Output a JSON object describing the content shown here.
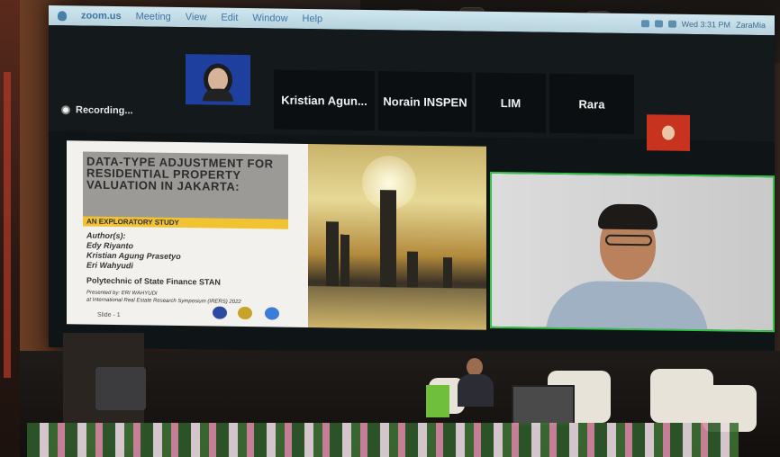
{
  "menubar": {
    "app_name": "zoom.us",
    "items": [
      "Meeting",
      "View",
      "Edit",
      "Window",
      "Help"
    ],
    "clock": "Wed 3:31 PM",
    "account": "ZaraMia"
  },
  "recording": {
    "label": "Recording..."
  },
  "participants": [
    {
      "name": "",
      "has_video": true
    },
    {
      "name": "Kristian Agun...",
      "has_video": false
    },
    {
      "name": "Norain INSPEN",
      "has_video": false
    },
    {
      "name": "LIM",
      "has_video": false
    },
    {
      "name": "Rara",
      "has_video": false
    },
    {
      "name": "",
      "has_video": true
    }
  ],
  "slide": {
    "title": "DATA-TYPE ADJUSTMENT FOR RESIDENTIAL PROPERTY VALUATION IN JAKARTA:",
    "subtitle": "AN EXPLORATORY STUDY",
    "authors_label": "Author(s):",
    "authors": [
      "Edy Riyanto",
      "Kristian Agung Prasetyo",
      "Eri Wahyudi"
    ],
    "institution": "Polytechnic of State Finance STAN",
    "presented_by": "Presented by: ERI WAHYUDI",
    "event": "at International Real Estate Research Symposium (IRERS) 2022",
    "slide_number": "Slide - 1"
  },
  "colors": {
    "active_speaker_border": "#35c24b",
    "subtitle_bar": "#f1c232",
    "menubar_text": "#3d77a6"
  }
}
